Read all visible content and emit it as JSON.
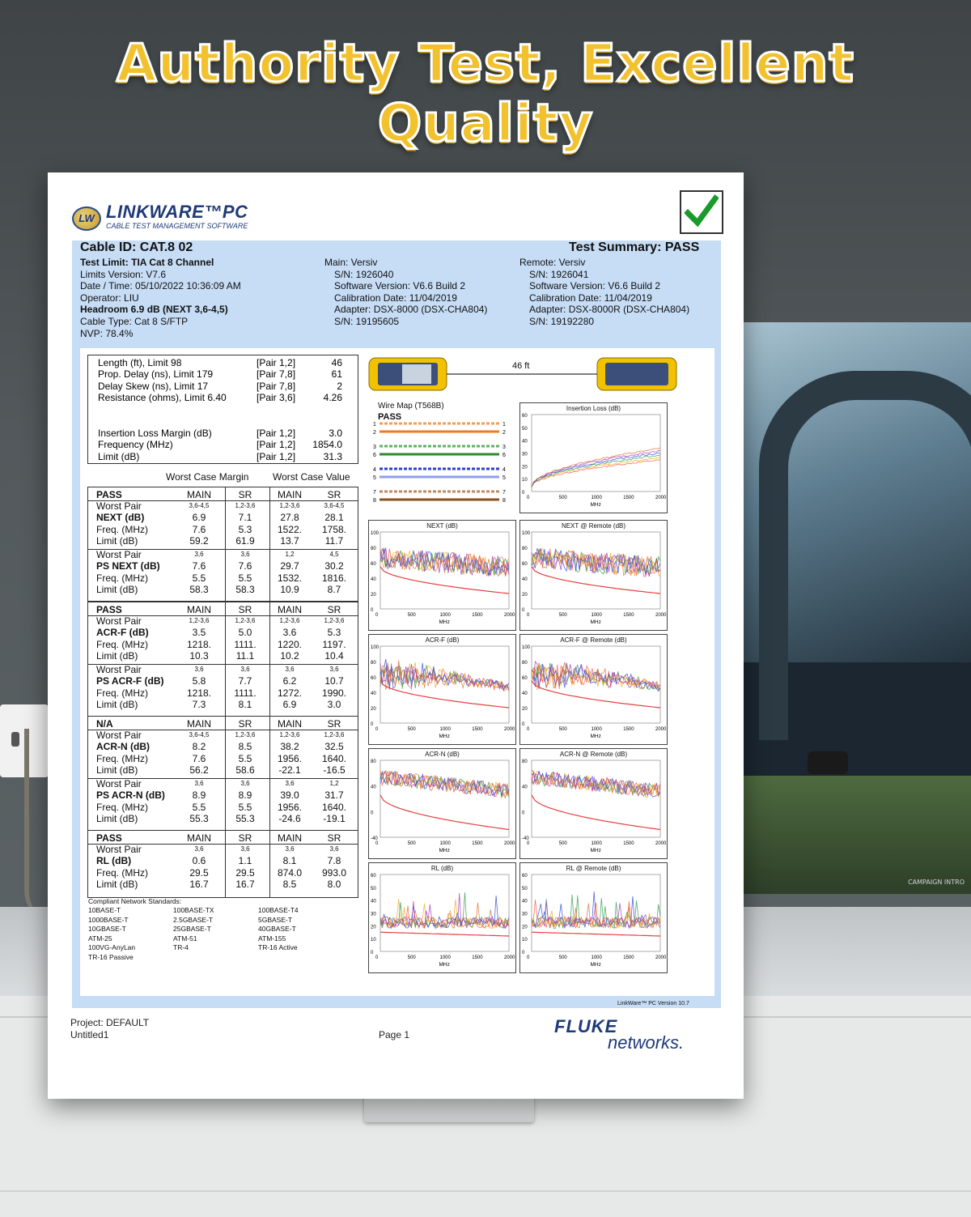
{
  "headline": "Authority Test, Excellent Quality",
  "logo": {
    "badge": "LW",
    "name": "LINKWARE™PC",
    "subtitle": "CABLE TEST MANAGEMENT SOFTWARE"
  },
  "tv_caption": "CAMPAIGN INTRO",
  "header": {
    "cable_id": "Cable ID: CAT.8  02",
    "test_summary": "Test Summary: PASS",
    "left_lines": [
      "Test Limit: TIA Cat 8 Channel",
      "Limits Version: V7.6",
      "Date / Time: 05/10/2022  10:36:09 AM",
      "Operator: LIU",
      "Headroom 6.9 dB (NEXT 3,6-4,5)",
      "Cable Type: Cat 8 S/FTP",
      "NVP: 78.4%"
    ],
    "main_lines": [
      "Main: Versiv",
      "S/N: 1926040",
      "Software Version: V6.6 Build 2",
      "Calibration Date: 11/04/2019",
      "Adapter: DSX-8000 (DSX-CHA804)",
      "S/N: 19195605"
    ],
    "remote_lines": [
      "Remote: Versiv",
      "S/N: 1926041",
      "Software Version: V6.6 Build 2",
      "Calibration Date: 11/04/2019",
      "Adapter: DSX-8000R (DSX-CHA804)",
      "S/N: 19192280"
    ]
  },
  "summary_box": [
    {
      "label": "Length (ft), Limit 98",
      "pair": "[Pair 1,2]",
      "value": "46"
    },
    {
      "label": "Prop. Delay (ns), Limit 179",
      "pair": "[Pair 7,8]",
      "value": "61"
    },
    {
      "label": "Delay Skew (ns), Limit 17",
      "pair": "[Pair 7,8]",
      "value": "2"
    },
    {
      "label": "Resistance (ohms), Limit 6.40",
      "pair": "[Pair 3,6]",
      "value": "4.26"
    },
    {
      "label": "Insertion Loss Margin (dB)",
      "pair": "[Pair 1,2]",
      "value": "3.0"
    },
    {
      "label": "Frequency (MHz)",
      "pair": "[Pair 1,2]",
      "value": "1854.0"
    },
    {
      "label": "Limit (dB)",
      "pair": "[Pair 1,2]",
      "value": "31.3"
    }
  ],
  "worst_case_margin": "Worst Case Margin",
  "worst_case_value": "Worst Case Value",
  "groups": [
    {
      "status": "PASS",
      "cols": [
        "MAIN",
        "SR",
        "MAIN",
        "SR"
      ],
      "blocks": [
        {
          "name": "NEXT (dB)",
          "pairs": [
            "3,6-4,5",
            "1,2-3,6",
            "1,2-3,6",
            "3,6-4,5"
          ],
          "freq": [
            "7.6",
            "5.3",
            "1522.",
            "1758."
          ],
          "val": [
            "6.9",
            "7.1",
            "27.8",
            "28.1"
          ],
          "limit": [
            "59.2",
            "61.9",
            "13.7",
            "11.7"
          ]
        },
        {
          "name": "PS NEXT (dB)",
          "pairs": [
            "3,6",
            "3,6",
            "1,2",
            "4,5"
          ],
          "freq": [
            "5.5",
            "5.5",
            "1532.",
            "1816."
          ],
          "val": [
            "7.6",
            "7.6",
            "29.7",
            "30.2"
          ],
          "limit": [
            "58.3",
            "58.3",
            "10.9",
            "8.7"
          ]
        }
      ]
    },
    {
      "status": "PASS",
      "cols": [
        "MAIN",
        "SR",
        "MAIN",
        "SR"
      ],
      "blocks": [
        {
          "name": "ACR-F (dB)",
          "pairs": [
            "1,2-3,6",
            "1,2-3,6",
            "1,2-3,6",
            "1,2-3,6"
          ],
          "freq": [
            "1218.",
            "1111.",
            "1220.",
            "1197."
          ],
          "val": [
            "3.5",
            "5.0",
            "3.6",
            "5.3"
          ],
          "limit": [
            "10.3",
            "11.1",
            "10.2",
            "10.4"
          ]
        },
        {
          "name": "PS ACR-F (dB)",
          "pairs": [
            "3,6",
            "3,6",
            "3,6",
            "3,6"
          ],
          "freq": [
            "1218.",
            "1111.",
            "1272.",
            "1990."
          ],
          "val": [
            "5.8",
            "7.7",
            "6.2",
            "10.7"
          ],
          "limit": [
            "7.3",
            "8.1",
            "6.9",
            "3.0"
          ]
        }
      ]
    },
    {
      "status": "N/A",
      "cols": [
        "MAIN",
        "SR",
        "MAIN",
        "SR"
      ],
      "blocks": [
        {
          "name": "ACR-N (dB)",
          "pairs": [
            "3,6-4,5",
            "1,2-3,6",
            "1,2-3,6",
            "1,2-3,6"
          ],
          "freq": [
            "7.6",
            "5.5",
            "1956.",
            "1640."
          ],
          "val": [
            "8.2",
            "8.5",
            "38.2",
            "32.5"
          ],
          "limit": [
            "56.2",
            "58.6",
            "-22.1",
            "-16.5"
          ]
        },
        {
          "name": "PS ACR-N (dB)",
          "pairs": [
            "3,6",
            "3,6",
            "3,6",
            "1,2"
          ],
          "freq": [
            "5.5",
            "5.5",
            "1956.",
            "1640."
          ],
          "val": [
            "8.9",
            "8.9",
            "39.0",
            "31.7"
          ],
          "limit": [
            "55.3",
            "55.3",
            "-24.6",
            "-19.1"
          ]
        }
      ]
    },
    {
      "status": "PASS",
      "cols": [
        "MAIN",
        "SR",
        "MAIN",
        "SR"
      ],
      "blocks": [
        {
          "name": "RL (dB)",
          "pairs": [
            "3,6",
            "3,6",
            "3,6",
            "3,6"
          ],
          "freq": [
            "29.5",
            "29.5",
            "874.0",
            "993.0"
          ],
          "val": [
            "0.6",
            "1.1",
            "8.1",
            "7.8"
          ],
          "limit": [
            "16.7",
            "16.7",
            "8.5",
            "8.0"
          ]
        }
      ]
    }
  ],
  "row_labels": {
    "worst_pair": "Worst Pair",
    "freq": "Freq. (MHz)",
    "limit": "Limit (dB)"
  },
  "standards": {
    "title": "Compliant Network Standards:",
    "cols": [
      [
        "10BASE-T",
        "1000BASE-T",
        "10GBASE-T",
        "ATM-25",
        "100VG-AnyLan",
        "TR-16 Passive"
      ],
      [
        "100BASE-TX",
        "2.5GBASE-T",
        "25GBASE-T",
        "ATM-51",
        "TR-4"
      ],
      [
        "100BASE-T4",
        "5GBASE-T",
        "40GBASE-T",
        "ATM-155",
        "TR-16 Active"
      ]
    ]
  },
  "length_label": "46 ft",
  "wiremap": {
    "title": "Wire Map (T568B)",
    "status": "PASS",
    "pins": [
      "1",
      "2",
      "3",
      "6",
      "4",
      "5",
      "7",
      "8"
    ],
    "colors": [
      "#f0a050",
      "#f07a20",
      "#60b060",
      "#2c8a2c",
      "#2a3fd0",
      "#8fa0e8",
      "#c08a60",
      "#8a5020"
    ]
  },
  "charts": [
    {
      "title": "Insertion Loss (dB)",
      "yticks": [
        "60",
        "50",
        "40",
        "30",
        "20",
        "10",
        "0"
      ],
      "xticks": [
        "0",
        "500",
        "1000",
        "1500",
        "2000"
      ],
      "xlabel": "MHz",
      "kind": "il"
    },
    {
      "title": "NEXT (dB)",
      "yticks": [
        "100",
        "80",
        "60",
        "40",
        "20",
        "0"
      ],
      "xticks": [
        "0",
        "500",
        "1000",
        "1500",
        "2000"
      ],
      "xlabel": "MHz",
      "kind": "noise_high"
    },
    {
      "title": "NEXT @ Remote (dB)",
      "yticks": [
        "100",
        "80",
        "60",
        "40",
        "20",
        "0"
      ],
      "xticks": [
        "0",
        "500",
        "1000",
        "1500",
        "2000"
      ],
      "xlabel": "MHz",
      "kind": "noise_high"
    },
    {
      "title": "ACR-F (dB)",
      "yticks": [
        "100",
        "80",
        "60",
        "40",
        "20",
        "0"
      ],
      "xticks": [
        "0",
        "500",
        "1000",
        "1500",
        "2000"
      ],
      "xlabel": "MHz",
      "kind": "acrf"
    },
    {
      "title": "ACR-F @ Remote (dB)",
      "yticks": [
        "100",
        "80",
        "60",
        "40",
        "20",
        "0"
      ],
      "xticks": [
        "0",
        "500",
        "1000",
        "1500",
        "2000"
      ],
      "xlabel": "MHz",
      "kind": "acrf"
    },
    {
      "title": "ACR-N (dB)",
      "yticks": [
        "80",
        "40",
        "0",
        "-40"
      ],
      "xticks": [
        "0",
        "500",
        "1000",
        "1500",
        "2000"
      ],
      "xlabel": "MHz",
      "kind": "acrn"
    },
    {
      "title": "ACR-N @ Remote (dB)",
      "yticks": [
        "80",
        "40",
        "0",
        "-40"
      ],
      "xticks": [
        "0",
        "500",
        "1000",
        "1500",
        "2000"
      ],
      "xlabel": "MHz",
      "kind": "acrn"
    },
    {
      "title": "RL (dB)",
      "yticks": [
        "60",
        "50",
        "40",
        "30",
        "20",
        "10",
        "0"
      ],
      "xticks": [
        "0",
        "500",
        "1000",
        "1500",
        "2000"
      ],
      "xlabel": "MHz",
      "kind": "rl"
    },
    {
      "title": "RL @ Remote (dB)",
      "yticks": [
        "60",
        "50",
        "40",
        "30",
        "20",
        "10",
        "0"
      ],
      "xticks": [
        "0",
        "500",
        "1000",
        "1500",
        "2000"
      ],
      "xlabel": "MHz",
      "kind": "rl"
    }
  ],
  "version": "LinkWare™ PC Version 10.7",
  "footer": {
    "project": "Project: DEFAULT",
    "untitled": "Untitled1",
    "page": "Page 1",
    "brand_top": "FLUKE",
    "brand_bottom": "networks."
  }
}
